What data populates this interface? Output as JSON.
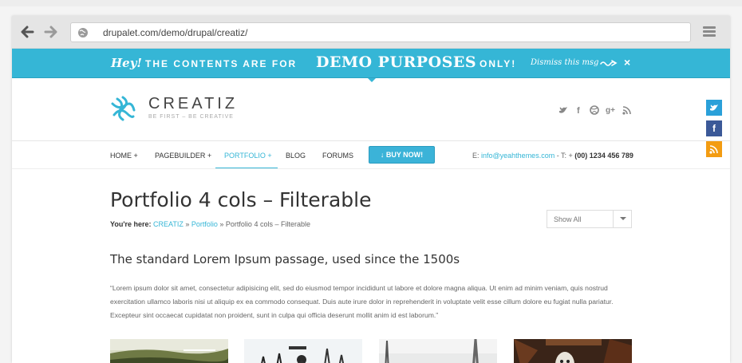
{
  "browser": {
    "url": "drupalet.com/demo/drupal/creatiz/"
  },
  "banner": {
    "hey": "Hey!",
    "contents_text": "THE CONTENTS ARE FOR",
    "demo_text": "DEMO PURPOSES",
    "only_text": "ONLY!",
    "dismiss": "Dismiss this msg",
    "close": "×"
  },
  "header": {
    "logo_name": "CREATIZ",
    "tagline": "BE FIRST – BE CREATIVE",
    "social": [
      "twitter-icon",
      "facebook-icon",
      "dribbble-icon",
      "googleplus-icon",
      "rss-icon"
    ]
  },
  "side_share": {
    "twitter": "t",
    "facebook": "f",
    "rss": "rss"
  },
  "nav": {
    "items": [
      {
        "label": "HOME +"
      },
      {
        "label": "PAGEBUILDER +"
      },
      {
        "label": "PORTFOLIO +"
      },
      {
        "label": "BLOG"
      },
      {
        "label": "FORUMS"
      }
    ],
    "active_index": 2,
    "buy_label": "BUY NOW!",
    "email_prefix": "E: ",
    "email": "info@yeahthemes.com",
    "phone_prefix": " - T: + ",
    "phone": "(00) 1234 456 789"
  },
  "page": {
    "title": "Portfolio 4 cols – Filterable",
    "breadcrumb_label": "You're here:",
    "breadcrumb": [
      "CREATIZ",
      "Portfolio",
      "Portfolio 4 cols – Filterable"
    ],
    "filter_value": "Show All",
    "section_heading": "The standard Lorem Ipsum passage, used since the 1500s",
    "paragraph": "“Lorem ipsum dolor sit amet, consectetur adipisicing elit, sed do eiusmod tempor incididunt ut labore et dolore magna aliqua. Ut enim ad minim veniam, quis nostrud exercitation ullamco laboris nisi ut aliquip ex ea commodo consequat. Duis aute irure dolor in reprehenderit in voluptate velit esse cillum dolore eu fugiat nulla pariatur. Excepteur sint occaecat cupidatat non proident, sunt in culpa qui officia deserunt mollit anim id est laborum.”"
  },
  "colors": {
    "accent": "#35b6d6",
    "text": "#333333"
  }
}
